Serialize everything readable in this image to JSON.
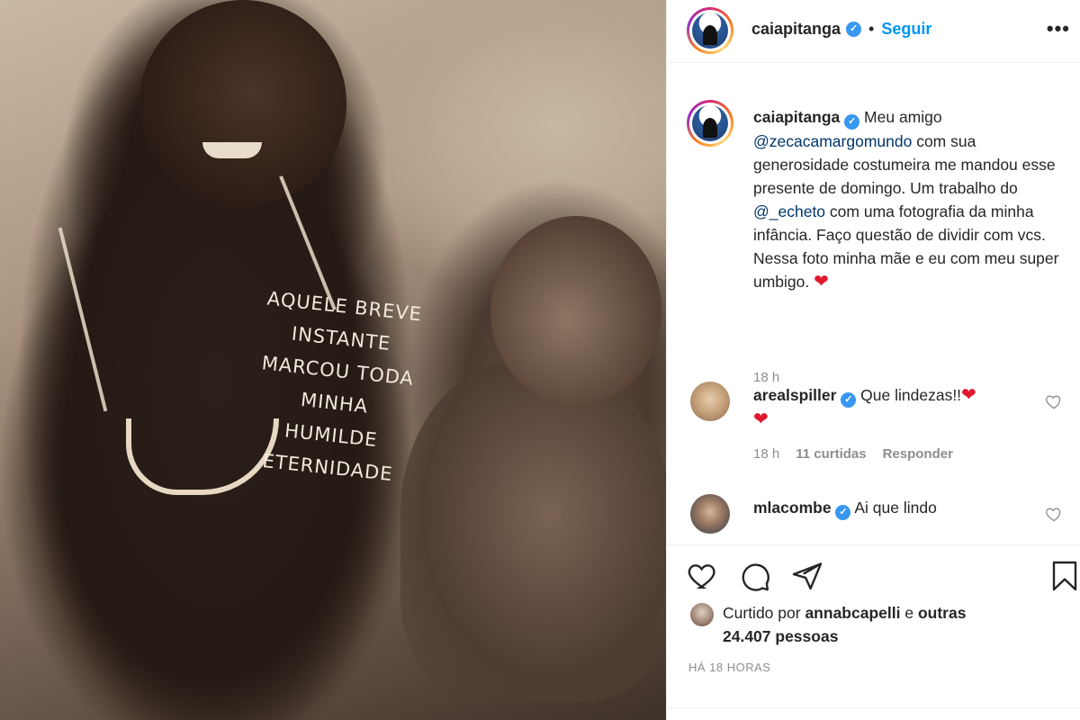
{
  "post": {
    "photo_caption_lines": [
      "AQUELE BREVE",
      "INSTANTE",
      "MARCOU TODA",
      "MINHA HUMILDE",
      "ETERNIDADE"
    ]
  },
  "header": {
    "username": "caiapitanga",
    "separator": "•",
    "follow_label": "Seguir",
    "more_icon": "more-horizontal-icon"
  },
  "caption": {
    "username": "caiapitanga",
    "text_1": "Meu amigo",
    "mention_1": "@zecacamargomundo",
    "text_2": "com sua generosidade costumeira me mandou esse presente de domingo. Um trabalho do",
    "mention_2": "@_echeto",
    "text_3": "com uma fotografia da minha infância. Faço questão de dividir com vcs. Nessa foto minha mãe e eu com meu super umbigo.",
    "emoji": "❤",
    "time": "18 h"
  },
  "comments": [
    {
      "username": "arealspiller",
      "text": "Que lindezas!!",
      "emoji_1": "❤",
      "emoji_2": "❤",
      "time": "18 h",
      "likes": "11 curtidas",
      "reply_label": "Responder"
    },
    {
      "username": "mlacombe",
      "text": "Ai que lindo"
    }
  ],
  "actions": {
    "like_icon": "heart-icon",
    "comment_icon": "comment-icon",
    "share_icon": "send-icon",
    "save_icon": "bookmark-icon"
  },
  "likes": {
    "prefix": "Curtido por",
    "user": "annabcapelli",
    "middle": "e",
    "others": "outras 24.407 pessoas"
  },
  "post_date": "HÁ 18 HORAS",
  "colors": {
    "accent": "#0095f6",
    "verified": "#3897f0",
    "heart": "#e0192f",
    "muted": "#8e8e8e"
  }
}
